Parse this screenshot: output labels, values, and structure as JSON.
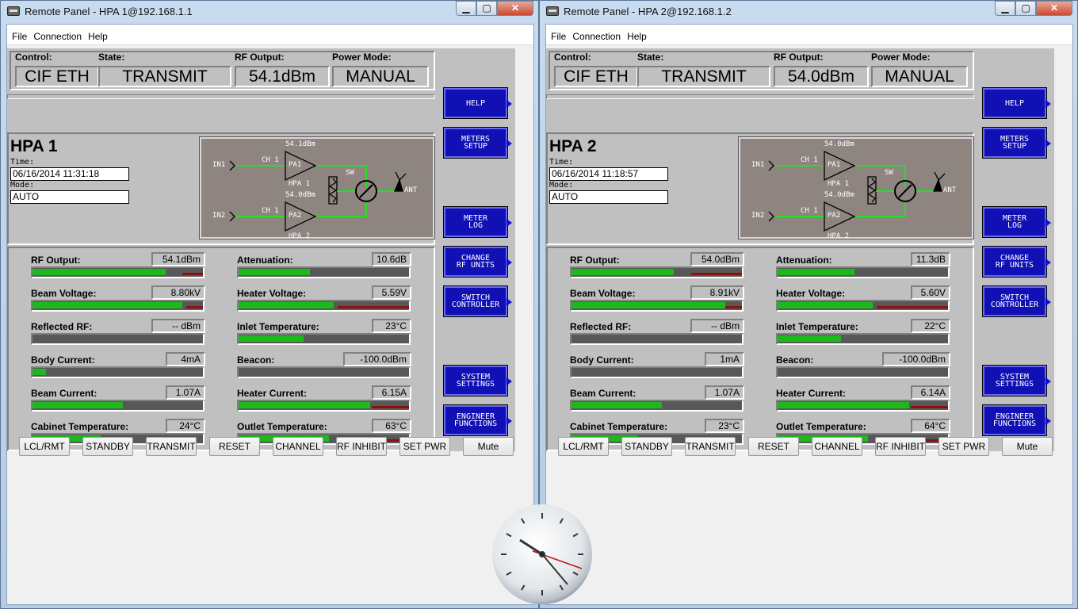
{
  "windows": [
    {
      "title": "Remote Panel - HPA 1@192.168.1.1",
      "menu": [
        "File",
        "Connection",
        "Help"
      ],
      "header": {
        "labels": [
          "Control:",
          "State:",
          "RF  Output:",
          "Power  Mode:"
        ],
        "values": [
          "CIF ETH",
          "TRANSMIT",
          "54.1dBm",
          "MANUAL"
        ]
      },
      "hpa_name": "HPA 1",
      "time_label": "Time:",
      "time": "06/16/2014  11:31:18",
      "mode_label": "Mode:",
      "mode": "AUTO",
      "diagram": {
        "pa1_power": "54.1dBm",
        "pa2_power": "54.0dBm",
        "in1": "IN1",
        "in2": "IN2",
        "ch1": "CH 1",
        "ch2": "CH 1",
        "pa1": "PA1",
        "pa2": "PA2",
        "hpa1": "HPA 1",
        "hpa2": "HPA 2",
        "sw": "SW",
        "ant": "ANT"
      },
      "meters": [
        {
          "label": "RF  Output:",
          "value": "54.1dBm",
          "level": 0.78,
          "red": 0.12
        },
        {
          "label": "Attenuation:",
          "value": "10.6dB",
          "level": 0.42,
          "red": 0
        },
        {
          "label": "Beam  Voltage:",
          "value": "8.80kV",
          "level": 0.88,
          "red": 0.1
        },
        {
          "label": "Heater  Voltage:",
          "value": "5.59V",
          "level": 0.56,
          "red": 0.42
        },
        {
          "label": "Reflected  RF:",
          "value": "--  dBm",
          "level": 0,
          "red": 0
        },
        {
          "label": "Inlet  Temperature:",
          "value": "23°C",
          "level": 0.38,
          "red": 0
        },
        {
          "label": "Body  Current:",
          "value": "4mA",
          "level": 0.08,
          "red": 0
        },
        {
          "label": "Beacon:",
          "value": "-100.0dBm",
          "level": 0,
          "red": 0
        },
        {
          "label": "Beam  Current:",
          "value": "1.07A",
          "level": 0.53,
          "red": 0
        },
        {
          "label": "Heater  Current:",
          "value": "6.15A",
          "level": 0.77,
          "red": 0.22
        },
        {
          "label": "Cabinet  Temperature:",
          "value": "24°C",
          "level": 0.4,
          "red": 0
        },
        {
          "label": "Outlet  Temperature:",
          "value": "63°C",
          "level": 0.53,
          "red": 0.2
        }
      ],
      "side_buttons": [
        "HELP",
        "METERS\nSETUP",
        "METER\nLOG",
        "CHANGE\nRF UNITS",
        "SWITCH\nCONTROLLER",
        "SYSTEM\nSETTINGS",
        "ENGINEER\nFUNCTIONS"
      ],
      "bottom_buttons": [
        "LCL/RMT",
        "STANDBY",
        "TRANSMIT",
        "RESET",
        "CHANNEL",
        "RF INHIBIT",
        "SET PWR",
        "Mute"
      ]
    },
    {
      "title": "Remote Panel - HPA 2@192.168.1.2",
      "menu": [
        "File",
        "Connection",
        "Help"
      ],
      "header": {
        "labels": [
          "Control:",
          "State:",
          "RF  Output:",
          "Power  Mode:"
        ],
        "values": [
          "CIF ETH",
          "TRANSMIT",
          "54.0dBm",
          "MANUAL"
        ]
      },
      "hpa_name": "HPA 2",
      "time_label": "Time:",
      "time": "06/16/2014  11:18:57",
      "mode_label": "Mode:",
      "mode": "AUTO",
      "diagram": {
        "pa1_power": "54.0dBm",
        "pa2_power": "54.0dBm",
        "in1": "IN1",
        "in2": "IN2",
        "ch1": "CH 1",
        "ch2": "CH 1",
        "pa1": "PA1",
        "pa2": "PA2",
        "hpa1": "HPA 1",
        "hpa2": "HPA 2",
        "sw": "SW",
        "ant": "ANT"
      },
      "meters": [
        {
          "label": "RF  Output:",
          "value": "54.0dBm",
          "level": 0.6,
          "red": 0.3
        },
        {
          "label": "Attenuation:",
          "value": "11.3dB",
          "level": 0.45,
          "red": 0
        },
        {
          "label": "Beam  Voltage:",
          "value": "8.91kV",
          "level": 0.9,
          "red": 0.1
        },
        {
          "label": "Heater  Voltage:",
          "value": "5.60V",
          "level": 0.56,
          "red": 0.42
        },
        {
          "label": "Reflected  RF:",
          "value": "--  dBm",
          "level": 0,
          "red": 0
        },
        {
          "label": "Inlet  Temperature:",
          "value": "22°C",
          "level": 0.37,
          "red": 0
        },
        {
          "label": "Body  Current:",
          "value": "1mA",
          "level": 0,
          "red": 0
        },
        {
          "label": "Beacon:",
          "value": "-100.0dBm",
          "level": 0,
          "red": 0
        },
        {
          "label": "Beam  Current:",
          "value": "1.07A",
          "level": 0.53,
          "red": 0
        },
        {
          "label": "Heater  Current:",
          "value": "6.14A",
          "level": 0.77,
          "red": 0.22
        },
        {
          "label": "Cabinet  Temperature:",
          "value": "23°C",
          "level": 0.39,
          "red": 0
        },
        {
          "label": "Outlet  Temperature:",
          "value": "64°C",
          "level": 0.53,
          "red": 0.2
        }
      ],
      "side_buttons": [
        "HELP",
        "METERS\nSETUP",
        "METER\nLOG",
        "CHANGE\nRF UNITS",
        "SWITCH\nCONTROLLER",
        "SYSTEM\nSETTINGS",
        "ENGINEER\nFUNCTIONS"
      ],
      "bottom_buttons": [
        "LCL/RMT",
        "STANDBY",
        "TRANSMIT",
        "RESET",
        "CHANNEL",
        "RF INHIBIT",
        "SET PWR",
        "Mute"
      ]
    }
  ],
  "colors": {
    "meter_green": "#1cb81c",
    "meter_red": "#8a1010",
    "diagram_line": "#22e022",
    "button_blue": "#1010b4"
  }
}
